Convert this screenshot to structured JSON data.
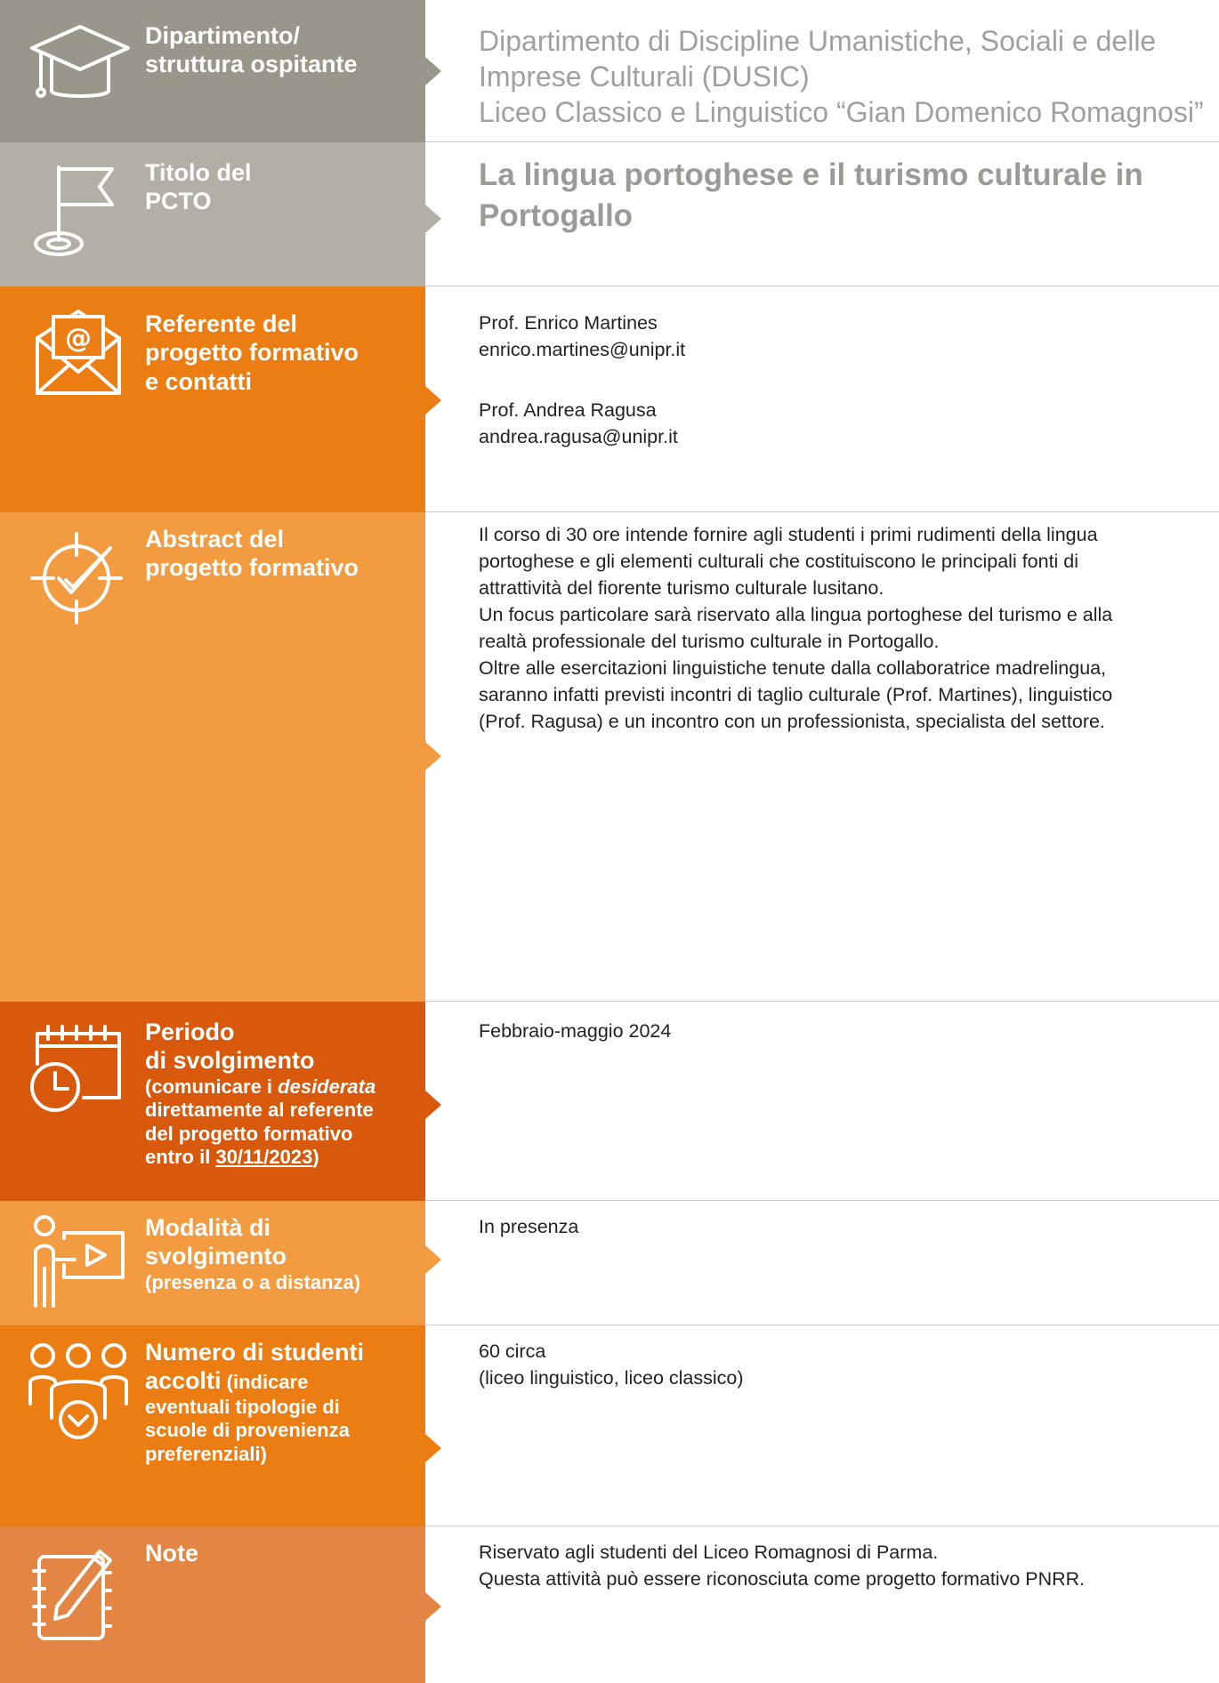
{
  "colors": {
    "gray_dark": "#99968c",
    "gray_light": "#b2afa6",
    "orange_main": "#ec7d13",
    "orange_light": "#f39b41",
    "orange_dark": "#d9590c",
    "orange_note": "#e38643",
    "rule": "#e8c98a"
  },
  "rows": {
    "dept": {
      "icon": "graduation-cap-icon",
      "label_l1": "Dipartimento/",
      "label_l2": "struttura ospitante",
      "lines": [
        "Dipartimento di Discipline Umanistiche, Sociali e delle",
        "Imprese Culturali (DUSIC)",
        "Liceo Classico e Linguistico “Gian Domenico Romagnosi”"
      ]
    },
    "title": {
      "icon": "flag-icon",
      "label_l1": "Titolo del",
      "label_l2": "PCTO",
      "lines": [
        "La lingua portoghese e il turismo culturale in",
        "Portogallo"
      ]
    },
    "ref": {
      "icon": "email-envelope-icon",
      "label_l1": "Referente del",
      "label_l2": "progetto formativo",
      "label_l3": "e contatti",
      "contact1_name": "Prof. Enrico Martines",
      "contact1_email": "enrico.martines@unipr.it",
      "contact2_name": "Prof. Andrea Ragusa",
      "contact2_email": "andrea.ragusa@unipr.it"
    },
    "abstract": {
      "icon": "target-check-icon",
      "label_l1": "Abstract del",
      "label_l2": "progetto formativo",
      "lines": [
        "Il corso di 30 ore intende fornire agli studenti i primi rudimenti della lingua",
        "portoghese e gli elementi culturali che costituiscono le principali fonti di",
        "attrattività del fiorente turismo culturale lusitano.",
        "Un focus particolare sarà riservato alla lingua portoghese del turismo e alla",
        "realtà professionale del turismo culturale in Portogallo.",
        "Oltre alle esercitazioni linguistiche tenute dalla collaboratrice madrelingua,",
        "saranno infatti previsti incontri di taglio culturale (Prof. Martines), linguistico",
        "(Prof. Ragusa) e un incontro con un professionista, specialista del settore."
      ]
    },
    "period": {
      "icon": "calendar-clock-icon",
      "label_l1": "Periodo",
      "label_l2": "di svolgimento",
      "note_a": "(comunicare i ",
      "note_em": "desiderata",
      "note_b": "direttamente al referente",
      "note_c": "del progetto formativo",
      "note_d": "entro il ",
      "note_date": "30/11/2023",
      "note_end": ")",
      "value": "Febbraio-maggio 2024"
    },
    "mode": {
      "icon": "presenter-screen-icon",
      "label_l1": "Modalità di",
      "label_l2": "svolgimento",
      "note": "(presenza o a distanza)",
      "value": "In presenza"
    },
    "students": {
      "icon": "people-group-icon",
      "label_l1": "Numero di studenti",
      "label_l2": "accolti",
      "note_inline": " (indicare",
      "note_b": "eventuali tipologie di",
      "note_c": "scuole di provenienza",
      "note_d": "preferenziali)",
      "value1": "60 circa",
      "value2": "(liceo linguistico, liceo classico)"
    },
    "note": {
      "icon": "notebook-pencil-icon",
      "label": "Note",
      "lines": [
        "Riservato agli studenti del Liceo Romagnosi di Parma.",
        "Questa attività può essere riconosciuta come progetto formativo PNRR."
      ]
    }
  }
}
